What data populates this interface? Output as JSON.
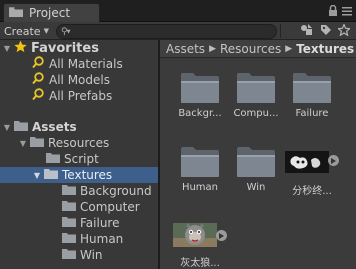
{
  "tab": {
    "title": "Project"
  },
  "toolbar": {
    "create_label": "Create",
    "search_placeholder": ""
  },
  "favorites": {
    "header": "Favorites",
    "items": [
      "All Materials",
      "All Models",
      "All Prefabs"
    ]
  },
  "assets_tree": {
    "root": "Assets",
    "resources": "Resources",
    "script": "Script",
    "textures": "Textures",
    "texture_children": [
      "Background",
      "Computer",
      "Failure",
      "Human",
      "Win"
    ]
  },
  "breadcrumb": [
    "Assets",
    "Resources",
    "Textures"
  ],
  "grid": {
    "items": [
      {
        "name": "Backgr...",
        "kind": "folder"
      },
      {
        "name": "Compu...",
        "kind": "folder"
      },
      {
        "name": "Failure",
        "kind": "folder"
      },
      {
        "name": "Human",
        "kind": "folder"
      },
      {
        "name": "Win",
        "kind": "folder"
      },
      {
        "name": "分秒终...",
        "kind": "image"
      },
      {
        "name": "灰太狼...",
        "kind": "image"
      }
    ]
  },
  "colors": {
    "selection": "#3e5f8c",
    "star": "#f2c40f",
    "search_icon": "#e3c22a",
    "folder": "#7e8791"
  }
}
